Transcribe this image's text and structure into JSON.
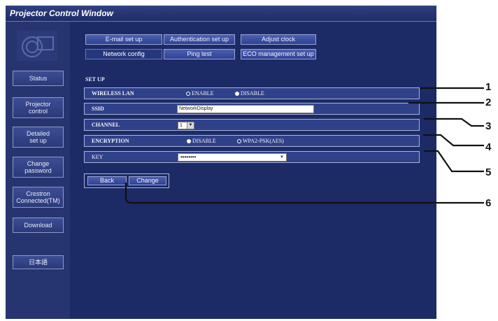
{
  "window": {
    "title": "Projector Control Window"
  },
  "sidebar": {
    "items": [
      {
        "label": "Status"
      },
      {
        "label": "Projector\ncontrol"
      },
      {
        "label": "Detailed\nset up"
      },
      {
        "label": "Change\npassword"
      },
      {
        "label": "Crestron\nConnected(TM)"
      },
      {
        "label": "Download"
      },
      {
        "label": "日本語"
      }
    ]
  },
  "tabs": {
    "email": "E-mail set up",
    "auth": "Authentication set up",
    "clock": "Adjust clock",
    "network": "Network config",
    "ping": "Ping test",
    "eco": "ECO management set up"
  },
  "form": {
    "section_title": "SET UP",
    "wireless_lan": {
      "label": "WIRELESS LAN",
      "options": [
        "ENABLE",
        "DISABLE"
      ],
      "selected": "DISABLE"
    },
    "ssid": {
      "label": "SSID",
      "value": "NetworkDisplay"
    },
    "channel": {
      "label": "CHANNEL",
      "value": "1"
    },
    "encryption": {
      "label": "ENCRYPTION",
      "options": [
        "DISABLE",
        "WPA2-PSK(AES)"
      ],
      "selected": "DISABLE"
    },
    "key": {
      "label": "KEY",
      "value": "••••••••"
    }
  },
  "buttons": {
    "back": "Back",
    "change": "Change"
  },
  "callouts": [
    "1",
    "2",
    "3",
    "4",
    "5",
    "6"
  ]
}
